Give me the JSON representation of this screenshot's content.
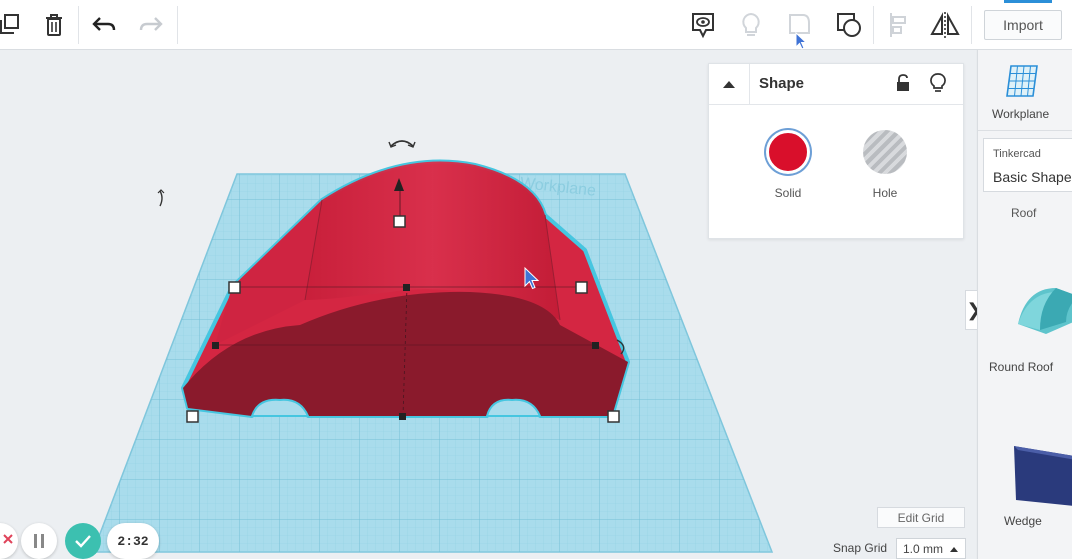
{
  "toolbar": {
    "import_label": "Import",
    "icons": [
      "copy-icon",
      "trash-icon",
      "undo-icon",
      "redo-icon",
      "notes-icon",
      "bulb-icon",
      "shape-icon",
      "group-icon",
      "align-icon",
      "mirror-icon"
    ]
  },
  "canvas": {
    "workplane_text": "Workplane"
  },
  "shape_panel": {
    "title": "Shape",
    "solid_label": "Solid",
    "hole_label": "Hole",
    "solid_color": "#d90f2b"
  },
  "right_panel": {
    "workplane_label": "Workplane",
    "library_source": "Tinkercad",
    "library_name": "Basic Shapes",
    "roof_label": "Roof",
    "round_roof_label": "Round Roof",
    "wedge_label": "Wedge"
  },
  "grid": {
    "edit_label": "Edit Grid",
    "snap_label": "Snap Grid",
    "snap_value": "1.0 mm"
  },
  "recording": {
    "time": "2:32"
  },
  "colors": {
    "car_body": "#d42642",
    "car_shadow": "#8a1a2c",
    "grid_fill": "#a9dcec",
    "grid_line": "#7fc6dc",
    "highlight": "#46c6e0"
  }
}
